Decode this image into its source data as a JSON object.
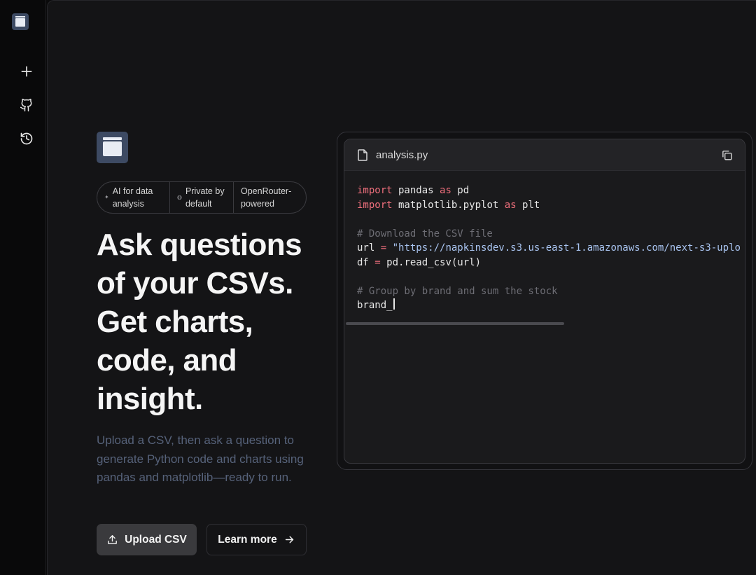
{
  "sidebar": {
    "logo_icon": "app-logo-icon",
    "items": [
      {
        "icon": "plus-icon",
        "label": "New"
      },
      {
        "icon": "github-icon",
        "label": "GitHub"
      },
      {
        "icon": "history-icon",
        "label": "History"
      }
    ]
  },
  "hero": {
    "pills": [
      {
        "line1": "AI for data",
        "line2": "analysis",
        "icon": "sparkle-icon"
      },
      {
        "line1": "Private by",
        "line2": "default",
        "icon": "shield-icon"
      },
      {
        "line1": "OpenRouter-",
        "line2": "powered",
        "icon": ""
      }
    ],
    "headline": "Ask questions of your CSVs. Get charts, code, and insight.",
    "subtext": "Upload a CSV, then ask a question to generate Python code and charts using pandas and matplotlib—ready to run.",
    "upload_label": "Upload CSV",
    "learn_label": "Learn more"
  },
  "code_panel": {
    "filename": "analysis.py",
    "lines": {
      "l1_kw": "import",
      "l1_mod": " pandas ",
      "l1_as": "as",
      "l1_alias": " pd",
      "l2_kw": "import",
      "l2_mod": " matplotlib.pyplot ",
      "l2_as": "as",
      "l2_alias": " plt",
      "l4_comment": "# Download the CSV file",
      "l5_var": "url ",
      "l5_op": "=",
      "l5_str": " \"https://napkinsdev.s3.us-east-1.amazonaws.com/next-s3-uplo",
      "l6_var": "df ",
      "l6_op": "=",
      "l6_rest": " pd.read_csv(url)",
      "l8_comment": "# Group by brand and sum the stock",
      "l9": "brand_"
    }
  },
  "colors": {
    "background": "#141416",
    "accent_logo": "#3d4a63",
    "keyword": "#ef6f7c",
    "string": "#a9c4f0",
    "comment": "#6d6d74",
    "subtext": "#56627a"
  }
}
